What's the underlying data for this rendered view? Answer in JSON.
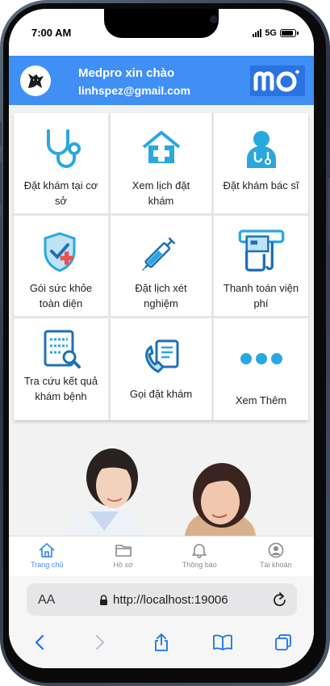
{
  "status_bar": {
    "time": "7:00 AM",
    "network": "5G",
    "battery_level": 0.9
  },
  "header": {
    "greeting": "Medpro xin chào",
    "email": "linhspez@gmail.com",
    "logo_text": "mo",
    "colors": {
      "background": "#3f8ff5",
      "logo_bg": "#2b73e0"
    }
  },
  "services": [
    {
      "label": "Đặt khám tại cơ sở",
      "icon": "stethoscope-icon"
    },
    {
      "label": "Xem lịch đặt khám",
      "icon": "calendar-hospital-icon"
    },
    {
      "label": "Đặt khám bác sĩ",
      "icon": "doctor-icon"
    },
    {
      "label": "Gói sức khỏe toàn diện",
      "icon": "health-shield-icon"
    },
    {
      "label": "Đặt lịch xét nghiệm",
      "icon": "syringe-icon"
    },
    {
      "label": "Thanh toán viện phí",
      "icon": "payment-terminal-icon"
    },
    {
      "label": "Tra cứu kết quả khám bệnh",
      "icon": "document-search-icon"
    },
    {
      "label": "Gọi đặt khám",
      "icon": "phone-booking-icon"
    },
    {
      "label": "Xem Thêm",
      "icon": "more-dots-icon"
    }
  ],
  "tabs": [
    {
      "label": "Trang chủ",
      "icon": "home-icon",
      "active": true
    },
    {
      "label": "Hồ sơ",
      "icon": "folder-icon",
      "active": false
    },
    {
      "label": "Thông báo",
      "icon": "bell-icon",
      "active": false
    },
    {
      "label": "Tài khoản",
      "icon": "account-icon",
      "active": false
    }
  ],
  "browser": {
    "text_size_label": "AA",
    "url": "http://localhost:19006"
  }
}
